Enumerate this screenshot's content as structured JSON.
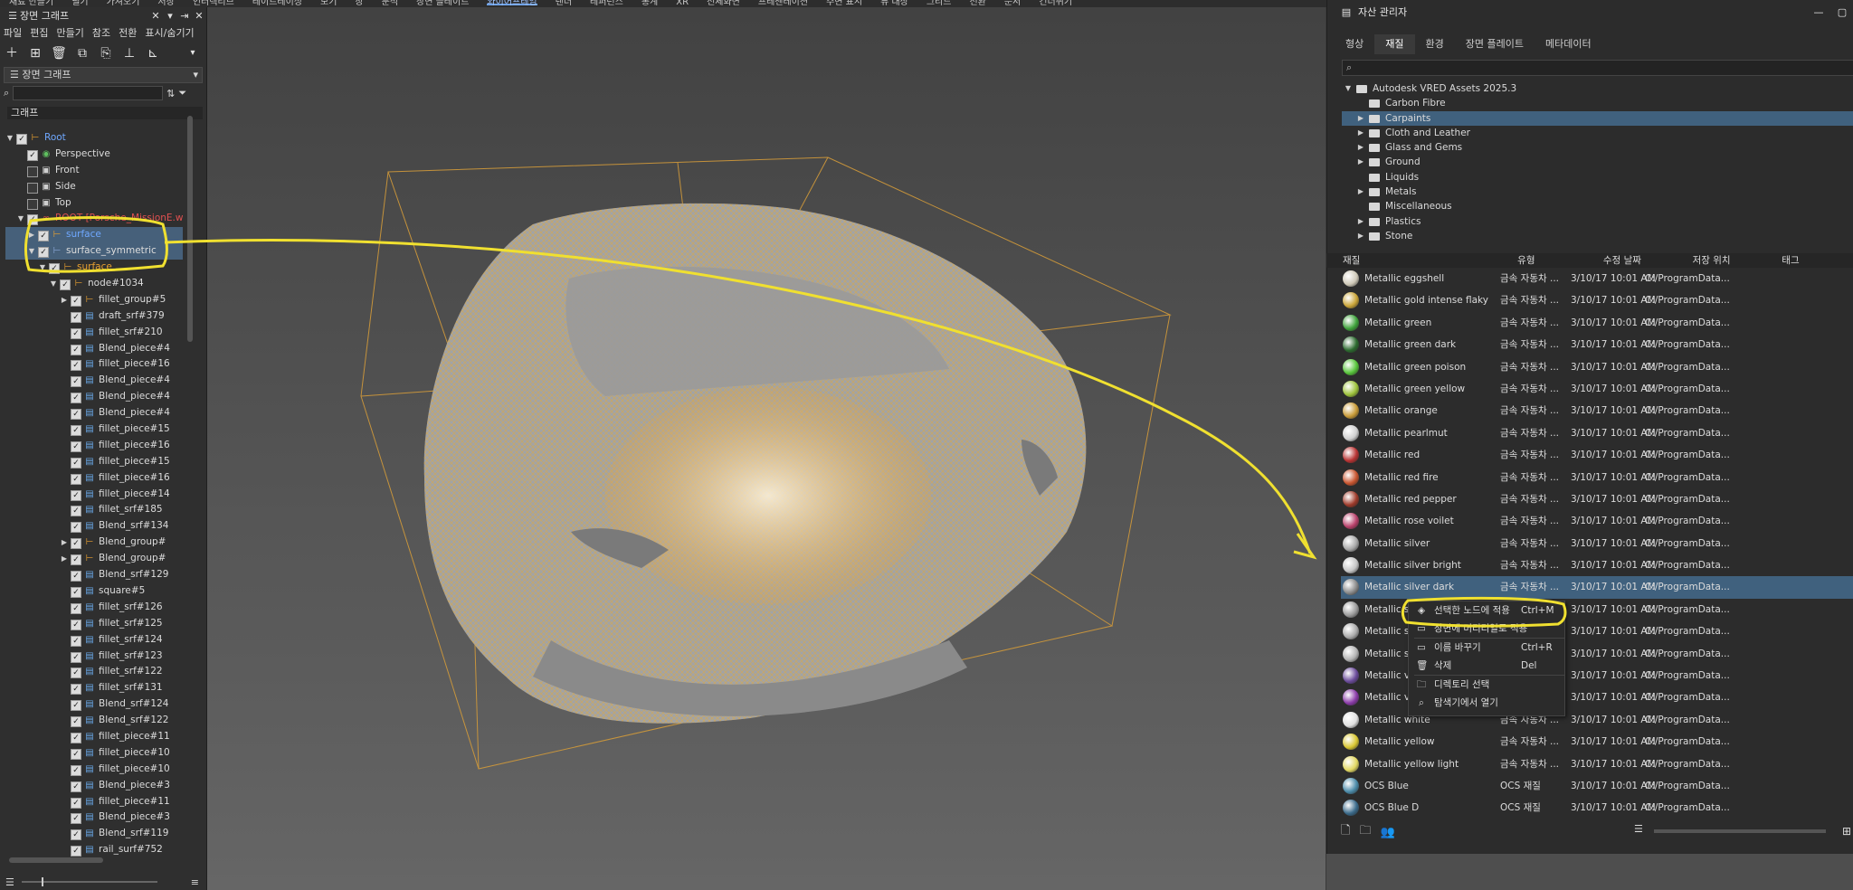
{
  "top_menu": [
    "재료 만들기",
    "필기",
    "가져오기",
    "저장",
    "인터렉티브",
    "레이트레이싱",
    "보기",
    "창",
    "분석",
    "장면 플레이트",
    "와이어프레임",
    "렌더",
    "레퍼런스",
    "통계",
    "XR",
    "전체화면",
    "프레젠테이션",
    "주변 표시",
    "뷰 대상",
    "그리드",
    "전환",
    "문서",
    "건너뛰기"
  ],
  "top_menu_active": "와이어프레임",
  "scene_graph": {
    "title": "장면 그래프",
    "menus": [
      "파일",
      "편집",
      "만들기",
      "참조",
      "전환",
      "표시/숨기기"
    ],
    "dropdown": "장면 그래프",
    "search_placeholder": "",
    "tree_header": "그래프",
    "nodes": [
      {
        "label": "Root",
        "indent": 0,
        "arrow": "▼",
        "check": true,
        "icon": "group",
        "color": "blue"
      },
      {
        "label": "Perspective",
        "indent": 1,
        "arrow": "",
        "check": true,
        "icon": "camera",
        "color": ""
      },
      {
        "label": "Front",
        "indent": 1,
        "arrow": "",
        "check": false,
        "icon": "camera-ortho",
        "color": ""
      },
      {
        "label": "Side",
        "indent": 1,
        "arrow": "",
        "check": false,
        "icon": "camera-ortho",
        "color": ""
      },
      {
        "label": "Top",
        "indent": 1,
        "arrow": "",
        "check": false,
        "icon": "camera-ortho",
        "color": ""
      },
      {
        "label": "ROOT [Porsche_MissionE.wire]",
        "indent": 1,
        "arrow": "▼",
        "check": true,
        "icon": "link",
        "color": "red"
      },
      {
        "label": "surface",
        "indent": 2,
        "arrow": "▶",
        "check": true,
        "icon": "group",
        "color": "blue",
        "selected": true
      },
      {
        "label": "surface_symmetric",
        "indent": 2,
        "arrow": "▼",
        "check": true,
        "icon": "group-sym",
        "color": "",
        "selected": true
      },
      {
        "label": "surface",
        "indent": 3,
        "arrow": "▼",
        "check": true,
        "icon": "group",
        "color": "orange"
      },
      {
        "label": "node#1034",
        "indent": 4,
        "arrow": "▼",
        "check": true,
        "icon": "group",
        "color": ""
      },
      {
        "label": "fillet_group#5",
        "indent": 5,
        "arrow": "▶",
        "check": true,
        "icon": "group",
        "color": ""
      },
      {
        "label": "draft_srf#379",
        "indent": 5,
        "arrow": "",
        "check": true,
        "icon": "surface",
        "color": ""
      },
      {
        "label": "fillet_srf#210",
        "indent": 5,
        "arrow": "",
        "check": true,
        "icon": "surface",
        "color": ""
      },
      {
        "label": "Blend_piece#4",
        "indent": 5,
        "arrow": "",
        "check": true,
        "icon": "surface",
        "color": ""
      },
      {
        "label": "fillet_piece#16",
        "indent": 5,
        "arrow": "",
        "check": true,
        "icon": "surface",
        "color": ""
      },
      {
        "label": "Blend_piece#4",
        "indent": 5,
        "arrow": "",
        "check": true,
        "icon": "surface",
        "color": ""
      },
      {
        "label": "Blend_piece#4",
        "indent": 5,
        "arrow": "",
        "check": true,
        "icon": "surface",
        "color": ""
      },
      {
        "label": "Blend_piece#4",
        "indent": 5,
        "arrow": "",
        "check": true,
        "icon": "surface",
        "color": ""
      },
      {
        "label": "fillet_piece#15",
        "indent": 5,
        "arrow": "",
        "check": true,
        "icon": "surface",
        "color": ""
      },
      {
        "label": "fillet_piece#16",
        "indent": 5,
        "arrow": "",
        "check": true,
        "icon": "surface",
        "color": ""
      },
      {
        "label": "fillet_piece#15",
        "indent": 5,
        "arrow": "",
        "check": true,
        "icon": "surface",
        "color": ""
      },
      {
        "label": "fillet_piece#16",
        "indent": 5,
        "arrow": "",
        "check": true,
        "icon": "surface",
        "color": ""
      },
      {
        "label": "fillet_piece#14",
        "indent": 5,
        "arrow": "",
        "check": true,
        "icon": "surface",
        "color": ""
      },
      {
        "label": "fillet_srf#185",
        "indent": 5,
        "arrow": "",
        "check": true,
        "icon": "surface",
        "color": ""
      },
      {
        "label": "Blend_srf#134",
        "indent": 5,
        "arrow": "",
        "check": true,
        "icon": "surface",
        "color": ""
      },
      {
        "label": "Blend_group#",
        "indent": 5,
        "arrow": "▶",
        "check": true,
        "icon": "group",
        "color": ""
      },
      {
        "label": "Blend_group#",
        "indent": 5,
        "arrow": "▶",
        "check": true,
        "icon": "group",
        "color": ""
      },
      {
        "label": "Blend_srf#129",
        "indent": 5,
        "arrow": "",
        "check": true,
        "icon": "surface",
        "color": ""
      },
      {
        "label": "square#5",
        "indent": 5,
        "arrow": "",
        "check": true,
        "icon": "surface",
        "color": ""
      },
      {
        "label": "fillet_srf#126",
        "indent": 5,
        "arrow": "",
        "check": true,
        "icon": "surface",
        "color": ""
      },
      {
        "label": "fillet_srf#125",
        "indent": 5,
        "arrow": "",
        "check": true,
        "icon": "surface",
        "color": ""
      },
      {
        "label": "fillet_srf#124",
        "indent": 5,
        "arrow": "",
        "check": true,
        "icon": "surface",
        "color": ""
      },
      {
        "label": "fillet_srf#123",
        "indent": 5,
        "arrow": "",
        "check": true,
        "icon": "surface",
        "color": ""
      },
      {
        "label": "fillet_srf#122",
        "indent": 5,
        "arrow": "",
        "check": true,
        "icon": "surface",
        "color": ""
      },
      {
        "label": "fillet_srf#131",
        "indent": 5,
        "arrow": "",
        "check": true,
        "icon": "surface",
        "color": ""
      },
      {
        "label": "Blend_srf#124",
        "indent": 5,
        "arrow": "",
        "check": true,
        "icon": "surface",
        "color": ""
      },
      {
        "label": "Blend_srf#122",
        "indent": 5,
        "arrow": "",
        "check": true,
        "icon": "surface",
        "color": ""
      },
      {
        "label": "fillet_piece#11",
        "indent": 5,
        "arrow": "",
        "check": true,
        "icon": "surface",
        "color": ""
      },
      {
        "label": "fillet_piece#10",
        "indent": 5,
        "arrow": "",
        "check": true,
        "icon": "surface",
        "color": ""
      },
      {
        "label": "fillet_piece#10",
        "indent": 5,
        "arrow": "",
        "check": true,
        "icon": "surface",
        "color": ""
      },
      {
        "label": "Blend_piece#3",
        "indent": 5,
        "arrow": "",
        "check": true,
        "icon": "surface",
        "color": ""
      },
      {
        "label": "fillet_piece#11",
        "indent": 5,
        "arrow": "",
        "check": true,
        "icon": "surface",
        "color": ""
      },
      {
        "label": "Blend_piece#3",
        "indent": 5,
        "arrow": "",
        "check": true,
        "icon": "surface",
        "color": ""
      },
      {
        "label": "Blend_srf#119",
        "indent": 5,
        "arrow": "",
        "check": true,
        "icon": "surface",
        "color": ""
      },
      {
        "label": "rail_surf#752",
        "indent": 5,
        "arrow": "",
        "check": true,
        "icon": "surface",
        "color": ""
      }
    ]
  },
  "asset_manager": {
    "title": "자산 관리자",
    "tabs": [
      "형상",
      "재질",
      "환경",
      "장면 플레이트",
      "메타데이터"
    ],
    "active_tab": "재질",
    "folders": [
      {
        "label": "Autodesk VRED Assets 2025.3",
        "indent": 0,
        "arrow": "▼"
      },
      {
        "label": "Carbon Fibre",
        "indent": 1,
        "arrow": ""
      },
      {
        "label": "Carpaints",
        "indent": 1,
        "arrow": "▶",
        "selected": true
      },
      {
        "label": "Cloth and Leather",
        "indent": 1,
        "arrow": "▶"
      },
      {
        "label": "Glass and Gems",
        "indent": 1,
        "arrow": "▶"
      },
      {
        "label": "Ground",
        "indent": 1,
        "arrow": "▶"
      },
      {
        "label": "Liquids",
        "indent": 1,
        "arrow": ""
      },
      {
        "label": "Metals",
        "indent": 1,
        "arrow": "▶"
      },
      {
        "label": "Miscellaneous",
        "indent": 1,
        "arrow": ""
      },
      {
        "label": "Plastics",
        "indent": 1,
        "arrow": "▶"
      },
      {
        "label": "Stone",
        "indent": 1,
        "arrow": "▶"
      }
    ],
    "columns": [
      "재질",
      "유형",
      "수정 날짜",
      "저장 위치",
      "태그"
    ],
    "materials": [
      {
        "name": "Metallic eggshell",
        "type": "금속 자동차 ...",
        "date": "3/10/17 10:01 AM",
        "loc": "C:/ProgramData...",
        "color": "#cfc9b8"
      },
      {
        "name": "Metallic gold intense flaky",
        "type": "금속 자동차 ...",
        "date": "3/10/17 10:01 AM",
        "loc": "C:/ProgramData...",
        "color": "#c9a437"
      },
      {
        "name": "Metallic green",
        "type": "금속 자동차 ...",
        "date": "3/10/17 10:01 AM",
        "loc": "C:/ProgramData...",
        "color": "#3ea23a"
      },
      {
        "name": "Metallic green dark",
        "type": "금속 자동차 ...",
        "date": "3/10/17 10:01 AM",
        "loc": "C:/ProgramData...",
        "color": "#2b6a2e"
      },
      {
        "name": "Metallic green poison",
        "type": "금속 자동차 ...",
        "date": "3/10/17 10:01 AM",
        "loc": "C:/ProgramData...",
        "color": "#57c43a"
      },
      {
        "name": "Metallic green yellow",
        "type": "금속 자동차 ...",
        "date": "3/10/17 10:01 AM",
        "loc": "C:/ProgramData...",
        "color": "#9dc23a"
      },
      {
        "name": "Metallic orange",
        "type": "금속 자동차 ...",
        "date": "3/10/17 10:01 AM",
        "loc": "C:/ProgramData...",
        "color": "#c89a36"
      },
      {
        "name": "Metallic pearlmut",
        "type": "금속 자동차 ...",
        "date": "3/10/17 10:01 AM",
        "loc": "C:/ProgramData...",
        "color": "#cfcfcf"
      },
      {
        "name": "Metallic red",
        "type": "금속 자동차 ...",
        "date": "3/10/17 10:01 AM",
        "loc": "C:/ProgramData...",
        "color": "#b83232"
      },
      {
        "name": "Metallic red fire",
        "type": "금속 자동차 ...",
        "date": "3/10/17 10:01 AM",
        "loc": "C:/ProgramData...",
        "color": "#c8542e"
      },
      {
        "name": "Metallic red pepper",
        "type": "금속 자동차 ...",
        "date": "3/10/17 10:01 AM",
        "loc": "C:/ProgramData...",
        "color": "#9e3a2a"
      },
      {
        "name": "Metallic rose voilet",
        "type": "금속 자동차 ...",
        "date": "3/10/17 10:01 AM",
        "loc": "C:/ProgramData...",
        "color": "#b8406a"
      },
      {
        "name": "Metallic silver",
        "type": "금속 자동차 ...",
        "date": "3/10/17 10:01 AM",
        "loc": "C:/ProgramData...",
        "color": "#a8a8a8"
      },
      {
        "name": "Metallic silver bright",
        "type": "금속 자동차 ...",
        "date": "3/10/17 10:01 AM",
        "loc": "C:/ProgramData...",
        "color": "#c6c6c6"
      },
      {
        "name": "Metallic silver dark",
        "type": "금속 자동차 ...",
        "date": "3/10/17 10:01 AM",
        "loc": "C:/ProgramData...",
        "color": "#8a8a8a",
        "selected": true
      },
      {
        "name": "Metallic silver",
        "type": "금속 자동차 ...",
        "date": "3/10/17 10:01 AM",
        "loc": "C:/ProgramData...",
        "color": "#9a9a9a"
      },
      {
        "name": "Metallic silver",
        "type": "금속 자동차 ...",
        "date": "3/10/17 10:01 AM",
        "loc": "C:/ProgramData...",
        "color": "#aaaaaa"
      },
      {
        "name": "Metallic silver",
        "type": "금속 자동차 ...",
        "date": "3/10/17 10:01 AM",
        "loc": "C:/ProgramData...",
        "color": "#b4b4b4"
      },
      {
        "name": "Metallic velvet",
        "type": "금속 자동차 ...",
        "date": "3/10/17 10:01 AM",
        "loc": "C:/ProgramData...",
        "color": "#6a4a9a"
      },
      {
        "name": "Metallic violet",
        "type": "금속 자동차 ...",
        "date": "3/10/17 10:01 AM",
        "loc": "C:/ProgramData...",
        "color": "#8a3aa8"
      },
      {
        "name": "Metallic white",
        "type": "금속 자동차 ...",
        "date": "3/10/17 10:01 AM",
        "loc": "C:/ProgramData...",
        "color": "#e0e0e0"
      },
      {
        "name": "Metallic yellow",
        "type": "금속 자동차 ...",
        "date": "3/10/17 10:01 AM",
        "loc": "C:/ProgramData...",
        "color": "#d8c632"
      },
      {
        "name": "Metallic yellow light",
        "type": "금속 자동차 ...",
        "date": "3/10/17 10:01 AM",
        "loc": "C:/ProgramData...",
        "color": "#e2d862"
      },
      {
        "name": "OCS Blue",
        "type": "OCS 재질",
        "date": "3/10/17 10:01 AM",
        "loc": "C:/ProgramData...",
        "color": "#4a8aa8"
      },
      {
        "name": "OCS Blue D",
        "type": "OCS 재질",
        "date": "3/10/17 10:01 AM",
        "loc": "C:/ProgramData...",
        "color": "#3a6a8a"
      }
    ]
  },
  "context_menu": [
    {
      "label": "선택한 노드에 적용",
      "shortcut": "Ctrl+M",
      "icon": "apply-icon"
    },
    {
      "label": "장면에 머티리얼로 적용",
      "shortcut": "",
      "icon": "scene-icon"
    },
    {
      "label": "이름 바꾸기",
      "shortcut": "Ctrl+R",
      "icon": "rename-icon"
    },
    {
      "label": "삭제",
      "shortcut": "Del",
      "icon": "trash-icon"
    },
    {
      "label": "디렉토리 선택",
      "shortcut": "",
      "icon": "folder-icon"
    },
    {
      "label": "탐색기에서 열기",
      "shortcut": "",
      "icon": "explorer-icon"
    }
  ],
  "annotation_color": "#f0e030",
  "wire_color": "#e8a830"
}
